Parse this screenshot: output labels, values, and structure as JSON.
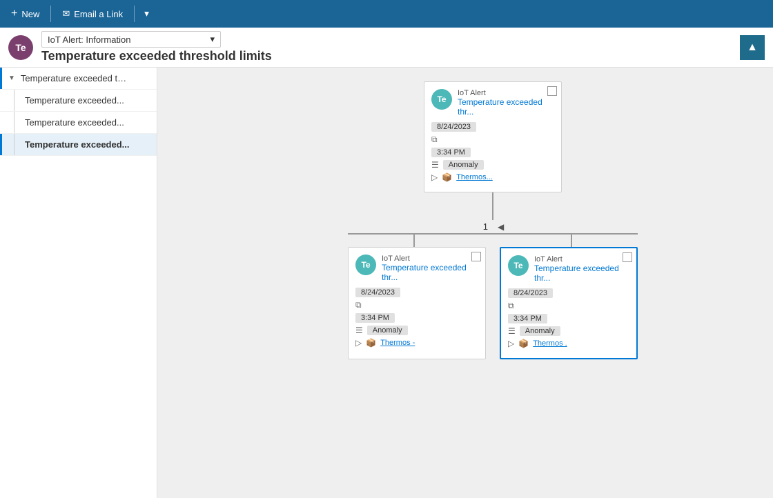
{
  "toolbar": {
    "new_label": "New",
    "email_label": "Email a Link",
    "plus_icon": "+",
    "email_icon": "✉",
    "dropdown_arrow": "▾"
  },
  "header": {
    "avatar_initials": "Te",
    "dropdown_label": "IoT Alert: Information",
    "title": "Temperature exceeded threshold limits",
    "collapse_icon": "▲"
  },
  "sidebar": {
    "items": [
      {
        "label": "Temperature exceeded thresh...",
        "level": 0,
        "active": false,
        "expanded": true
      },
      {
        "label": "Temperature exceeded...",
        "level": 1,
        "active": false
      },
      {
        "label": "Temperature exceeded...",
        "level": 1,
        "active": false
      },
      {
        "label": "Temperature exceeded...",
        "level": 1,
        "active": true
      }
    ]
  },
  "root_card": {
    "avatar": "Te",
    "type": "IoT Alert",
    "title": "Temperature exceeded thr...",
    "date": "8/24/2023",
    "time": "3:34 PM",
    "category": "Anomaly",
    "link": "Thermos..."
  },
  "child_left": {
    "avatar": "Te",
    "type": "IoT Alert",
    "title": "Temperature exceeded thr...",
    "date": "8/24/2023",
    "time": "3:34 PM",
    "category": "Anomaly",
    "link": "Thermos -"
  },
  "child_right": {
    "avatar": "Te",
    "type": "IoT Alert",
    "title": "Temperature exceeded thr...",
    "date": "8/24/2023",
    "time": "3:34 PM",
    "category": "Anomaly",
    "link": "Thermos ."
  },
  "pagination": {
    "current": "1",
    "arrow": "◀"
  },
  "colors": {
    "toolbar_bg": "#1a6496",
    "avatar_bg": "#4db8b8",
    "header_avatar_bg": "#7b3f6e",
    "selected_border": "#0078d4"
  }
}
